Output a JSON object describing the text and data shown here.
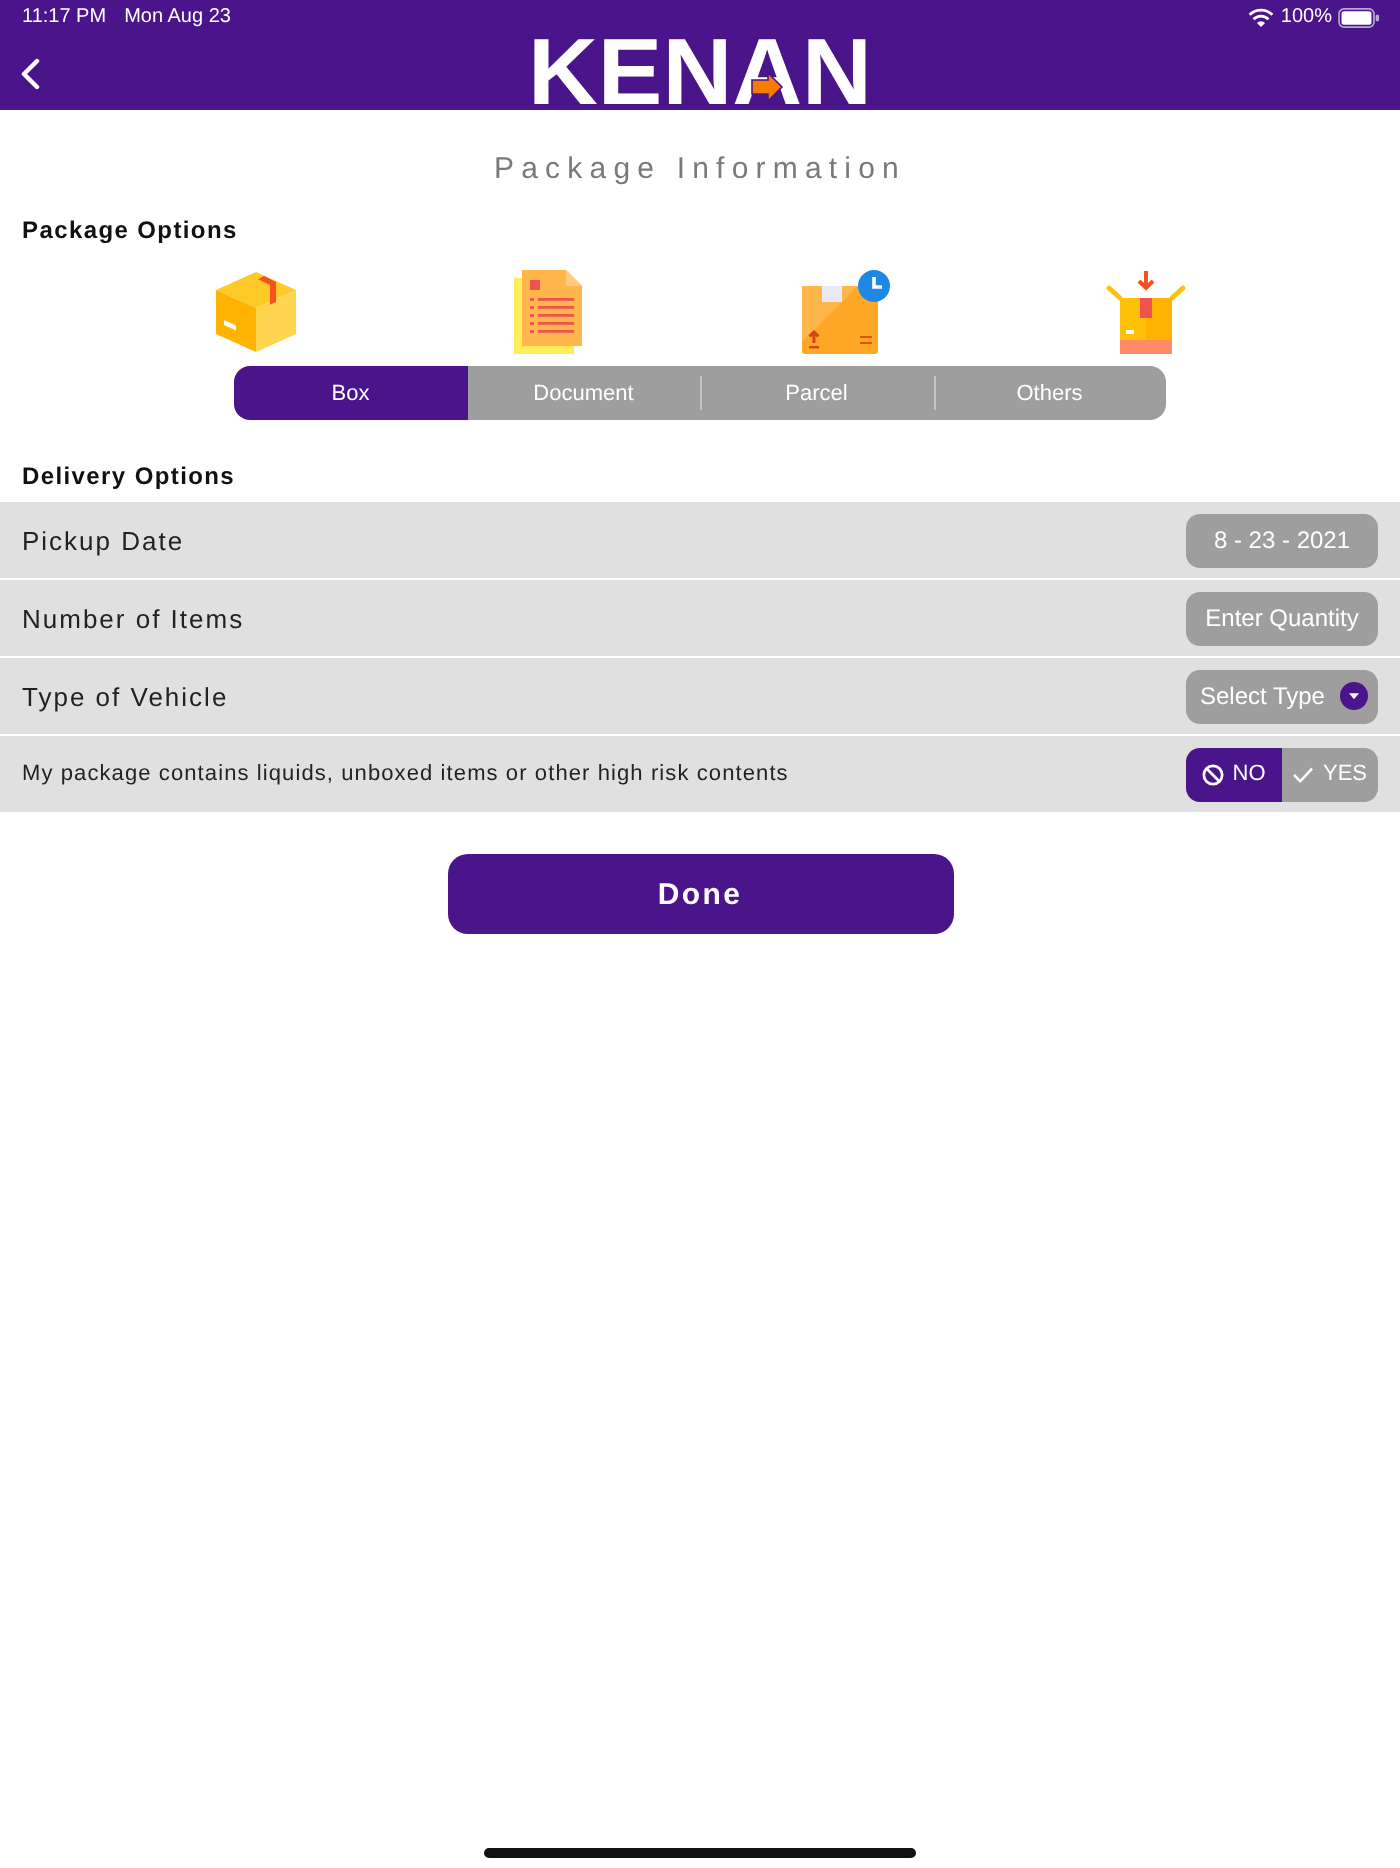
{
  "status_bar": {
    "time": "11:17 PM",
    "date": "Mon Aug 23",
    "battery": "100%"
  },
  "nav_bar": {
    "logo": "KENAN"
  },
  "page_title": "Package Information",
  "package_options": {
    "heading": "Package Options",
    "types": [
      {
        "kind": "box",
        "label": "Box",
        "selected": true
      },
      {
        "kind": "document",
        "label": "Document",
        "selected": false
      },
      {
        "kind": "parcel",
        "label": "Parcel",
        "selected": false
      },
      {
        "kind": "others",
        "label": "Others",
        "selected": false
      }
    ]
  },
  "delivery_options": {
    "heading": "Delivery Options",
    "rows": [
      {
        "kind": "date",
        "label": "Pickup Date",
        "value": "8 - 23 - 2021"
      },
      {
        "kind": "quantity",
        "label": "Number of Items",
        "placeholder": "Enter Quantity"
      },
      {
        "kind": "select",
        "label": "Type of Vehicle",
        "placeholder": "Select Type"
      },
      {
        "kind": "toggle",
        "label": "My package contains liquids, unboxed items or other high risk contents",
        "options": [
          {
            "kind": "no",
            "label": "NO",
            "selected": true
          },
          {
            "kind": "yes",
            "label": "YES",
            "selected": false
          }
        ]
      }
    ]
  },
  "done_button": "Done"
}
